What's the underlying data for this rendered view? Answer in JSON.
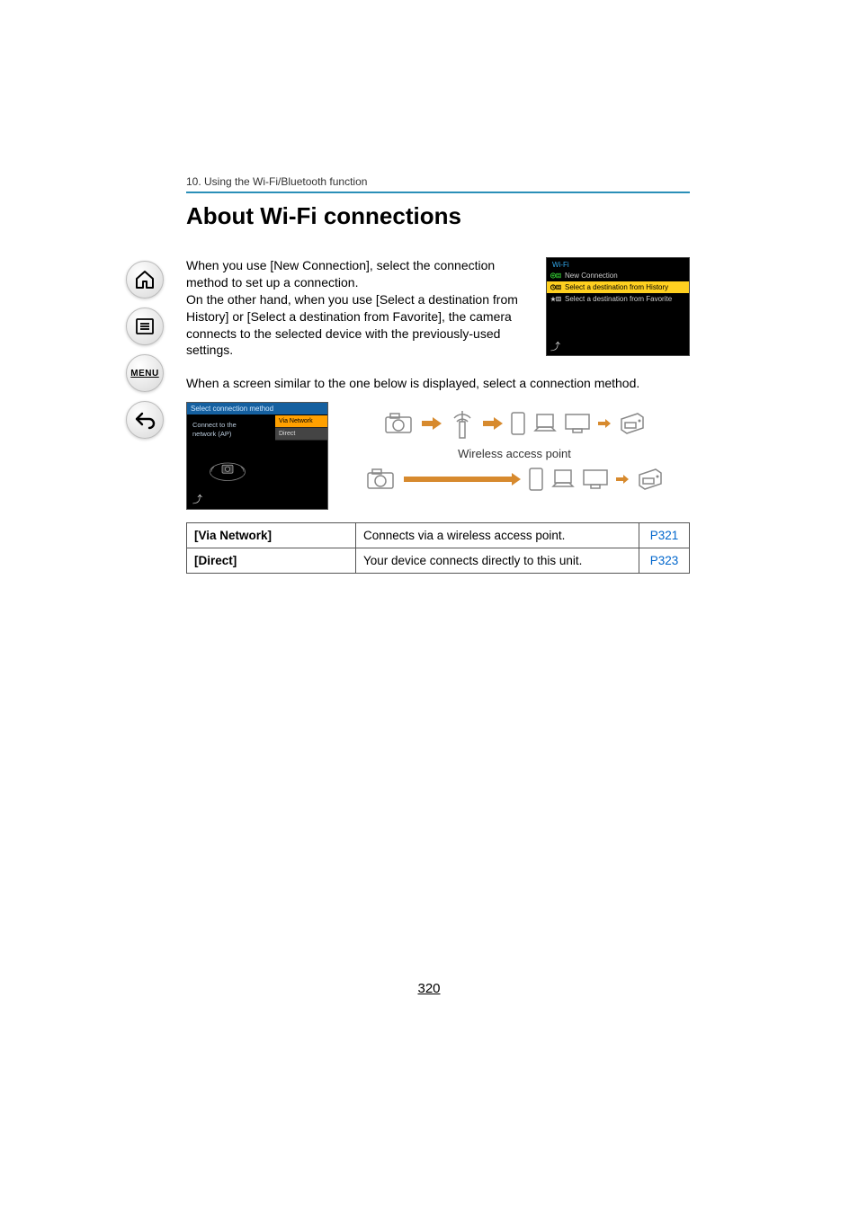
{
  "breadcrumb": "10. Using the Wi-Fi/Bluetooth function",
  "heading": "About Wi-Fi connections",
  "intro_p1": "When you use [New Connection], select the connection method to set up a connection.",
  "intro_p2": "On the other hand, when you use [Select a destination from History] or [Select a destination from Favorite], the camera connects to the selected device with the previously-used settings.",
  "followup": "When a screen similar to the one below is displayed, select a connection method.",
  "wifi_menu": {
    "title": "Wi-Fi",
    "items": [
      "New Connection",
      "Select a destination from History",
      "Select a destination from Favorite"
    ]
  },
  "camera_menu": {
    "header": "Select connection method",
    "left1": "Connect to the",
    "left2": "network (AP)",
    "opt1": "Via Network",
    "opt2": "Direct"
  },
  "diagram_label": "Wireless access point",
  "table": {
    "rows": [
      {
        "label": "[Via Network]",
        "desc": "Connects via a wireless access point.",
        "page": "P321"
      },
      {
        "label": "[Direct]",
        "desc": "Your device connects directly to this unit.",
        "page": "P323"
      }
    ]
  },
  "sidebar": {
    "menu_label": "MENU"
  },
  "page_number": "320"
}
